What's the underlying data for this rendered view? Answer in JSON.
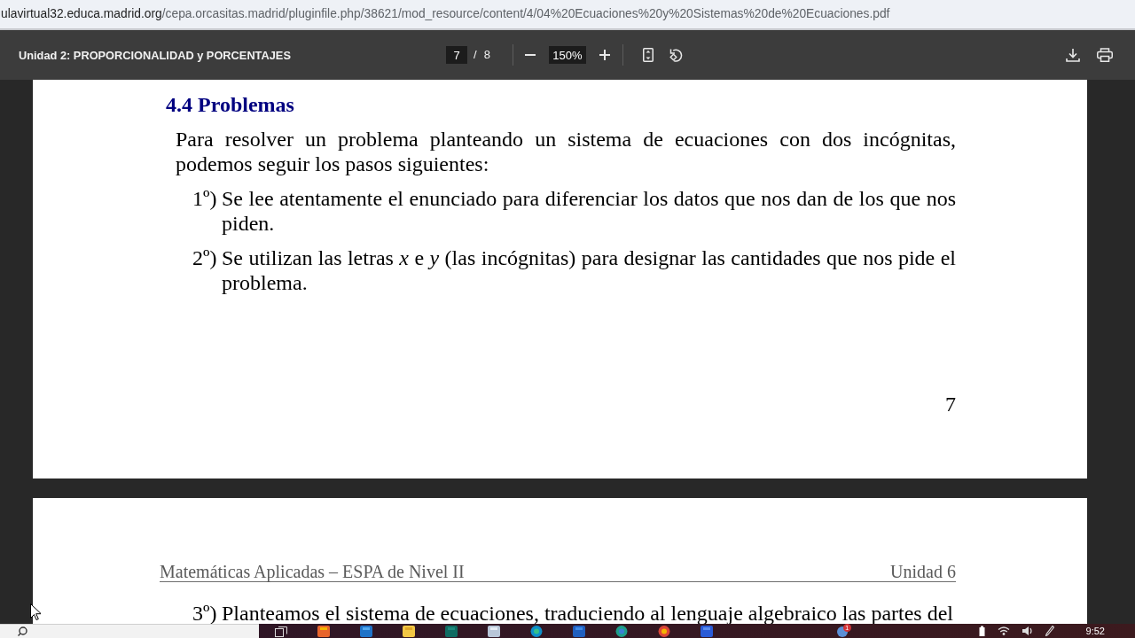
{
  "address_bar": {
    "url_host": "ulavirtual32.educa.madrid.org",
    "url_path": "/cepa.orcasitas.madrid/pluginfile.php/38621/mod_resource/content/4/04%20Ecuaciones%20y%20Sistemas%20de%20Ecuaciones.pdf"
  },
  "pdf_toolbar": {
    "title": "Unidad 2: PROPORCIONALIDAD y PORCENTAJES",
    "page_number": "7",
    "page_separator": "/",
    "page_count": "8",
    "zoom": "150%"
  },
  "pages": [
    {
      "heading": "4.4 Problemas",
      "paragraph": "Para resolver un problema planteando un sistema de ecuaciones con dos incógnitas, podemos seguir los pasos siguientes:",
      "steps": [
        {
          "number": "1º)",
          "text": "Se lee atentamente el enunciado para diferenciar los datos que nos dan de los que nos piden."
        },
        {
          "number": "2º)",
          "text": "Se utilizan las letras *x* e *y* (las incógnitas) para designar las cantidades que nos pide el problema."
        }
      ],
      "page_number": "7"
    },
    {
      "running_header": {
        "left": "Matemáticas Aplicadas – ESPA de Nivel II",
        "right": "Unidad 6"
      },
      "steps": [
        {
          "number": "3º)",
          "text": "Planteamos el sistema de ecuaciones, traduciendo al lenguaje algebraico las partes del"
        }
      ]
    }
  ],
  "taskbar": {
    "notification_badge": "1",
    "clock": "9:52"
  }
}
